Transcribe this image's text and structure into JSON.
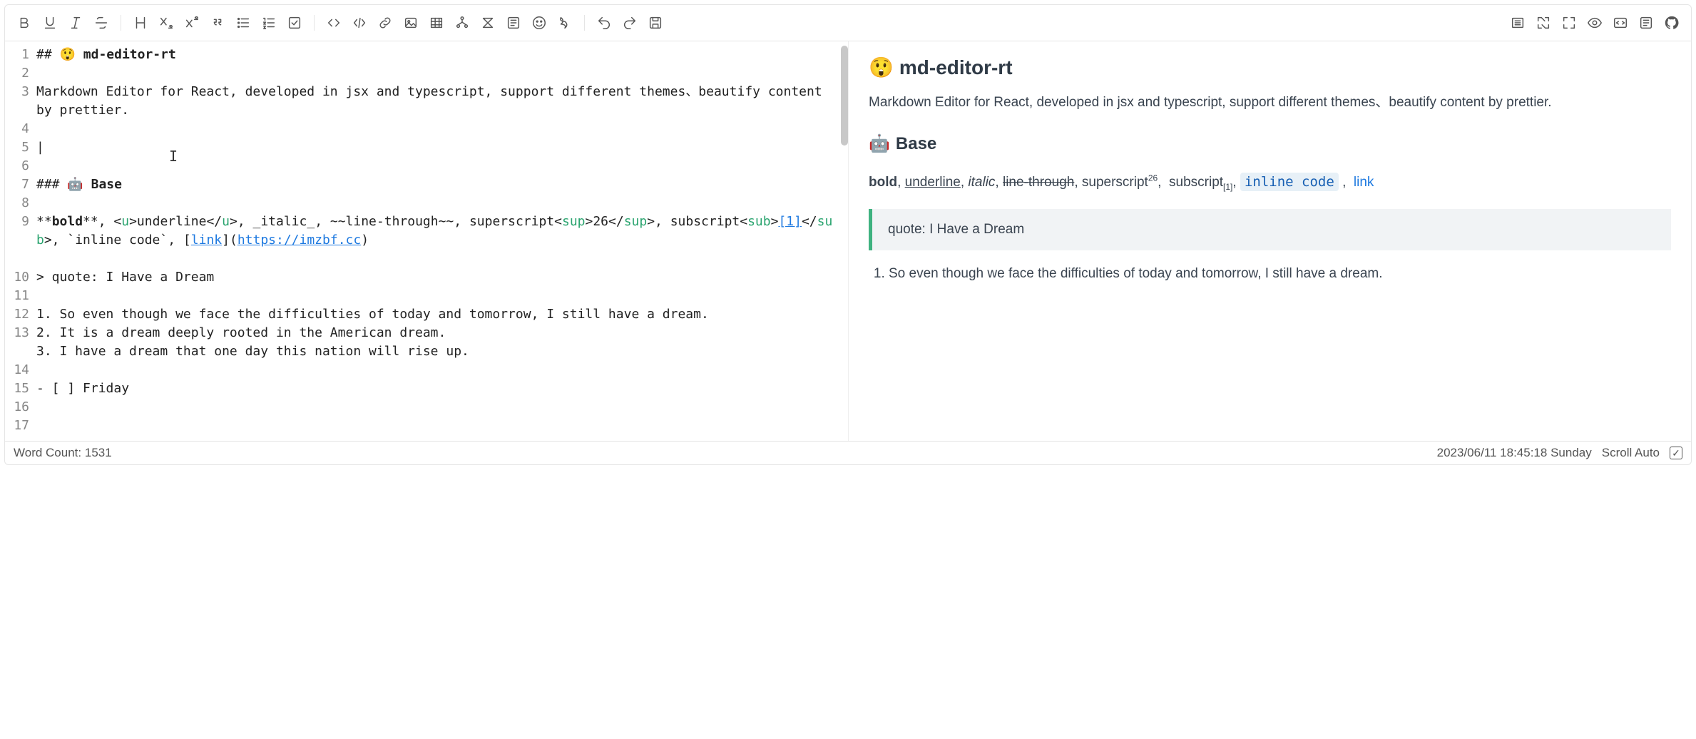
{
  "toolbar": {
    "left": [
      {
        "name": "bold-button",
        "icon": "bold"
      },
      {
        "name": "underline-button",
        "icon": "underline"
      },
      {
        "name": "italic-button",
        "icon": "italic"
      },
      {
        "name": "strikethrough-button",
        "icon": "strike"
      },
      {
        "name": "divider"
      },
      {
        "name": "heading-button",
        "icon": "heading"
      },
      {
        "name": "subscript-button",
        "icon": "subscript"
      },
      {
        "name": "superscript-button",
        "icon": "superscript"
      },
      {
        "name": "quote-button",
        "icon": "quote"
      },
      {
        "name": "unordered-list-button",
        "icon": "ul"
      },
      {
        "name": "ordered-list-button",
        "icon": "ol"
      },
      {
        "name": "task-list-button",
        "icon": "task"
      },
      {
        "name": "divider"
      },
      {
        "name": "code-block-button",
        "icon": "codeblock"
      },
      {
        "name": "inline-code-button",
        "icon": "inlinecode"
      },
      {
        "name": "link-button",
        "icon": "link"
      },
      {
        "name": "image-button",
        "icon": "image"
      },
      {
        "name": "table-button",
        "icon": "table"
      },
      {
        "name": "mermaid-button",
        "icon": "mermaid"
      },
      {
        "name": "katex-button",
        "icon": "katex"
      },
      {
        "name": "codemirror-button",
        "icon": "codemirror"
      },
      {
        "name": "emoji-button",
        "icon": "emoji"
      },
      {
        "name": "prettier-button",
        "icon": "prettier"
      },
      {
        "name": "divider"
      },
      {
        "name": "undo-button",
        "icon": "undo"
      },
      {
        "name": "redo-button",
        "icon": "redo"
      },
      {
        "name": "save-button",
        "icon": "save"
      }
    ],
    "right": [
      {
        "name": "page-fullscreen-button",
        "icon": "pagefull"
      },
      {
        "name": "fullscreen-button",
        "icon": "fullscreen"
      },
      {
        "name": "expand-button",
        "icon": "expand"
      },
      {
        "name": "preview-toggle-button",
        "icon": "preview"
      },
      {
        "name": "html-preview-button",
        "icon": "htmlpv"
      },
      {
        "name": "catalog-button",
        "icon": "catalog"
      },
      {
        "name": "github-button",
        "icon": "github"
      }
    ]
  },
  "source": {
    "lines": [
      {
        "n": 1,
        "parts": [
          {
            "t": "## 😲 ",
            "c": ""
          },
          {
            "t": "md-editor-rt",
            "c": "bold"
          }
        ]
      },
      {
        "n": 2,
        "parts": []
      },
      {
        "n": 3,
        "parts": [
          {
            "t": "Markdown Editor for React, developed in jsx and typescript, support different themes、beautify content by prettier.",
            "c": ""
          }
        ]
      },
      {
        "n": 4,
        "parts": []
      },
      {
        "n": 5,
        "parts": [
          {
            "t": "|",
            "c": ""
          }
        ]
      },
      {
        "n": 6,
        "parts": []
      },
      {
        "n": 7,
        "parts": [
          {
            "t": "### 🤖 ",
            "c": ""
          },
          {
            "t": "Base",
            "c": "bold"
          }
        ]
      },
      {
        "n": 8,
        "parts": []
      },
      {
        "n": 9,
        "parts": [
          {
            "t": "**",
            "c": ""
          },
          {
            "t": "bold",
            "c": "bold"
          },
          {
            "t": "**",
            "c": ""
          },
          {
            "t": ", <",
            "c": ""
          },
          {
            "t": "u",
            "c": "tag"
          },
          {
            "t": ">underline</",
            "c": ""
          },
          {
            "t": "u",
            "c": "tag"
          },
          {
            "t": ">, ",
            "c": ""
          },
          {
            "t": "_italic_",
            "c": ""
          },
          {
            "t": ", ~~line-through~~, superscript<",
            "c": ""
          },
          {
            "t": "sup",
            "c": "tag"
          },
          {
            "t": ">26</",
            "c": ""
          },
          {
            "t": "sup",
            "c": "tag"
          },
          {
            "t": ">, subscript<",
            "c": ""
          },
          {
            "t": "sub",
            "c": "tag"
          },
          {
            "t": ">",
            "c": ""
          },
          {
            "t": "[1]",
            "c": "link"
          },
          {
            "t": "</",
            "c": ""
          },
          {
            "t": "sub",
            "c": "tag"
          },
          {
            "t": ">, `inline code`, ",
            "c": ""
          },
          {
            "t": "[",
            "c": ""
          },
          {
            "t": "link",
            "c": "link"
          },
          {
            "t": "]",
            "c": ""
          },
          {
            "t": "(",
            "c": ""
          },
          {
            "t": "https://imzbf.cc",
            "c": "url"
          },
          {
            "t": ")",
            "c": ""
          }
        ]
      },
      {
        "n": 10,
        "parts": []
      },
      {
        "n": 11,
        "parts": [
          {
            "t": "> quote: I Have a Dream",
            "c": ""
          }
        ]
      },
      {
        "n": 12,
        "parts": []
      },
      {
        "n": 13,
        "parts": [
          {
            "t": "1. So even though we face the difficulties of today and tomorrow, I still have a dream.",
            "c": ""
          }
        ]
      },
      {
        "n": 14,
        "parts": [
          {
            "t": "2. It is a dream deeply rooted in the American dream.",
            "c": ""
          }
        ]
      },
      {
        "n": 15,
        "parts": [
          {
            "t": "3. I have a dream that one day this nation will rise up.",
            "c": ""
          }
        ]
      },
      {
        "n": 16,
        "parts": []
      },
      {
        "n": 17,
        "parts": [
          {
            "t": "- [ ] Friday",
            "c": ""
          }
        ]
      }
    ]
  },
  "preview": {
    "h2_emoji": "😲",
    "h2_text": "md-editor-rt",
    "para1": "Markdown Editor for React, developed in jsx and typescript, support different themes、beautify content by prettier.",
    "h3_emoji": "🤖",
    "h3_text": "Base",
    "fmt_bold": "bold",
    "fmt_underline": "underline",
    "fmt_italic": "italic",
    "fmt_strike": "line-through",
    "fmt_sup_label": "superscript",
    "fmt_sup": "26",
    "fmt_sub_label": "subscript",
    "fmt_sub": "[1]",
    "fmt_code": "inline code",
    "fmt_link": "link",
    "quote": "quote: I Have a Dream",
    "ol1": "So even though we face the difficulties of today and tomorrow, I still have a dream."
  },
  "footer": {
    "wordcount_label": "Word Count:",
    "wordcount_value": "1531",
    "timestamp": "2023/06/11 18:45:18 Sunday",
    "scroll_label": "Scroll Auto",
    "scroll_checked": true
  }
}
